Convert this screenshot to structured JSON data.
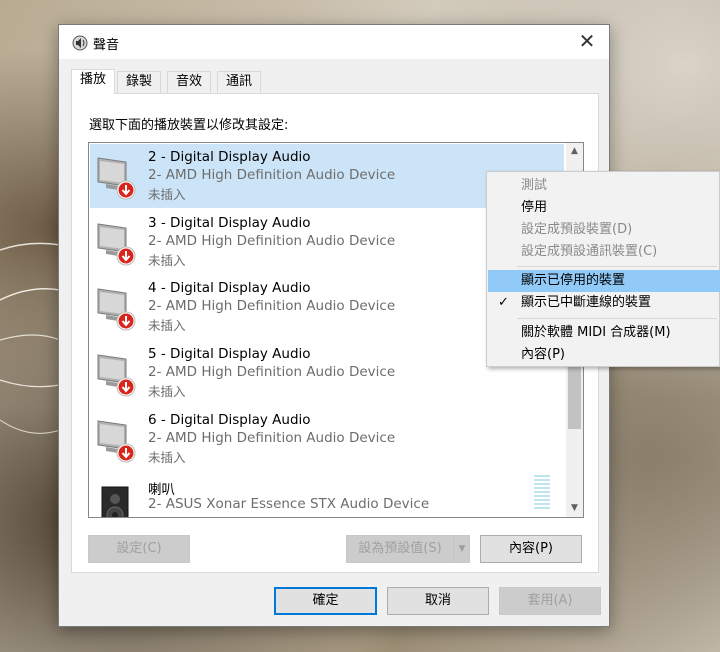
{
  "window": {
    "title": "聲音",
    "close_label": "✕"
  },
  "tabs": [
    {
      "label": "播放",
      "active": true
    },
    {
      "label": "錄製",
      "active": false
    },
    {
      "label": "音效",
      "active": false
    },
    {
      "label": "通訊",
      "active": false
    }
  ],
  "instruction": "選取下面的播放裝置以修改其設定:",
  "devices": [
    {
      "name": "2 - Digital Display Audio",
      "description": "2- AMD High Definition Audio Device",
      "status": "未插入",
      "selected": true
    },
    {
      "name": "3 - Digital Display Audio",
      "description": "2- AMD High Definition Audio Device",
      "status": "未插入",
      "selected": false
    },
    {
      "name": "4 - Digital Display Audio",
      "description": "2- AMD High Definition Audio Device",
      "status": "未插入",
      "selected": false
    },
    {
      "name": "5 - Digital Display Audio",
      "description": "2- AMD High Definition Audio Device",
      "status": "未插入",
      "selected": false
    },
    {
      "name": "6 - Digital Display Audio",
      "description": "2- AMD High Definition Audio Device",
      "status": "未插入",
      "selected": false
    },
    {
      "name": "喇叭",
      "description": "2- ASUS Xonar Essence STX Audio Device",
      "status": "",
      "selected": false
    }
  ],
  "buttons": {
    "configure": "設定(C)",
    "set_default": "設為預設值(S)",
    "properties": "內容(P)",
    "ok": "確定",
    "cancel": "取消",
    "apply": "套用(A)"
  },
  "context_menu": {
    "items": [
      {
        "label": "測試",
        "disabled": true
      },
      {
        "label": "停用",
        "disabled": false
      },
      {
        "label": "設定成預設裝置(D)",
        "disabled": true
      },
      {
        "label": "設定成預設通訊裝置(C)",
        "disabled": true
      },
      {
        "label": "顯示已停用的裝置",
        "disabled": false,
        "highlighted": true
      },
      {
        "label": "顯示已中斷連線的裝置",
        "disabled": false,
        "checked": true
      },
      {
        "label": "關於軟體 MIDI 合成器(M)",
        "disabled": false
      },
      {
        "label": "內容(P)",
        "disabled": false
      }
    ],
    "check_mark": "✓"
  },
  "colors": {
    "selection": "#cce4f7",
    "menu_highlight": "#91c9f7",
    "default_button_border": "#0078d7",
    "warning_red": "#d9261c"
  },
  "icons": {
    "title": "speaker-icon",
    "device": "monitor-speaker-icon",
    "status_overlay": "red-down-arrow-icon",
    "speaker_device": "speaker-box-icon"
  }
}
